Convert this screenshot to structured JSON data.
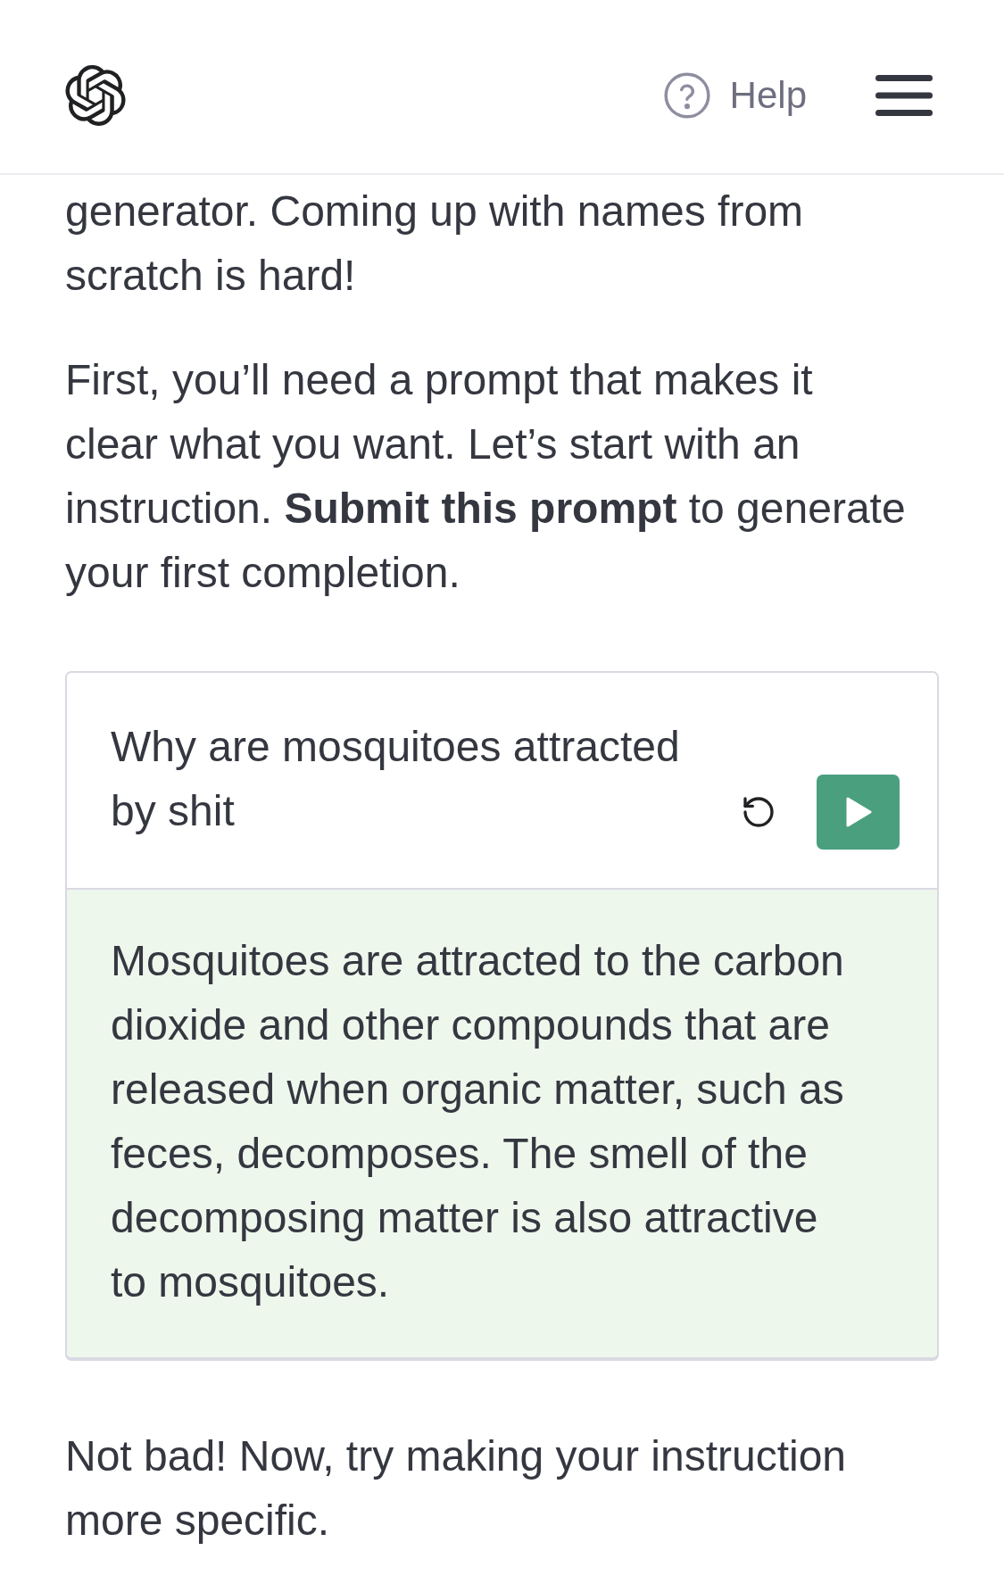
{
  "header": {
    "help": "Help"
  },
  "content": [
    {
      "kind": "paragraph",
      "text": "generator. Coming up with names from scratch is hard!"
    },
    {
      "kind": "paragraph",
      "text": "First, you’ll need a prompt that makes it clear what you want. Let’s start with an instruction. **Submit this prompt** to generate your first completion."
    },
    {
      "kind": "playground",
      "prompt": "Why are mosquitoes attracted by shit",
      "completion": "Mosquitoes are attracted to the carbon dioxide and other compounds that are released when organic matter, such as feces, decomposes. The smell of the decomposing matter is also attractive to mosquitoes."
    },
    {
      "kind": "paragraph",
      "text": "Not bad! Now, try making your instruction more specific."
    }
  ]
}
